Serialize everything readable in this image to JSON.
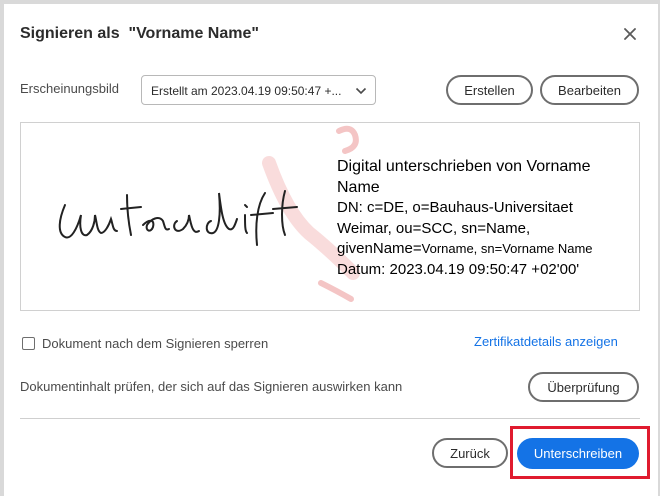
{
  "dialog": {
    "title": "Signieren als  \"Vorname Name\""
  },
  "appearance": {
    "label": "Erscheinungsbild",
    "selected": "Erstellt am 2023.04.19 09:50:47 +...",
    "create_button": "Erstellen",
    "edit_button": "Bearbeiten"
  },
  "preview": {
    "handwriting": "Unterschrift",
    "lines": [
      "Digital unterschrieben von Vorname",
      "Name",
      "DN: c=DE, o=Bauhaus-Universitaet",
      "Weimar, ou=SCC, sn=Name,",
      "givenName=",
      "Vorname, sn=Vorname Name",
      "Datum: 2023.04.19 09:50:47 +02'00'"
    ]
  },
  "options": {
    "lock_document_label": "Dokument nach dem Signieren sperren",
    "lock_document_checked": false,
    "certificate_link": "Zertifikatdetails anzeigen",
    "check_text": "Dokumentinhalt prüfen, der sich auf das Signieren auswirken kann",
    "review_button": "Überprüfung"
  },
  "footer": {
    "back_button": "Zurück",
    "sign_button": "Unterschreiben"
  },
  "colors": {
    "accent": "#1473e6",
    "highlight": "#e01b2f",
    "watermark": "#f4c5c5"
  },
  "icons": {
    "close": "close-icon",
    "dropdown": "chevron-down-icon",
    "checkbox": "checkbox-icon",
    "watermark": "watermark-icon"
  }
}
